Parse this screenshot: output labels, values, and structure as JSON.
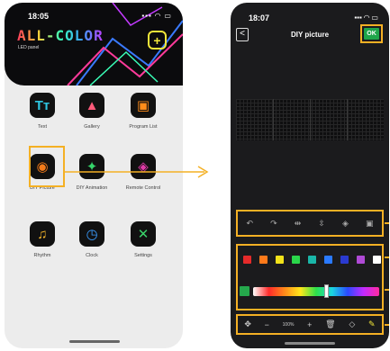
{
  "phone_left": {
    "time": "18:05",
    "status_icons": "▪▪▪ ◠ ▭",
    "logo": "ALL-COLOR",
    "subtitle": "LED panel",
    "add_symbol": "+",
    "tiles": [
      {
        "label": "Text",
        "icon": "text-icon",
        "glyph": "Tт",
        "color": "#2ec5e0"
      },
      {
        "label": "Gallery",
        "icon": "gallery-icon",
        "glyph": "▲",
        "color": "#ff5a7a"
      },
      {
        "label": "Program List",
        "icon": "program-list-icon",
        "glyph": "▣",
        "color": "#ff8c1a"
      },
      {
        "label": "DIY Picture",
        "icon": "palette-icon",
        "glyph": "◉",
        "color": "#f47b1a"
      },
      {
        "label": "DIY Animation",
        "icon": "running-figure-icon",
        "glyph": "✦",
        "color": "#35d46a"
      },
      {
        "label": "Remote Control",
        "icon": "gamepad-icon",
        "glyph": "◈",
        "color": "#e23aa8"
      },
      {
        "label": "Rhythm",
        "icon": "music-note-icon",
        "glyph": "♫",
        "color": "#f5b52a"
      },
      {
        "label": "Clock",
        "icon": "clock-icon",
        "glyph": "◷",
        "color": "#3a9cff"
      },
      {
        "label": "Settings",
        "icon": "tools-icon",
        "glyph": "✕",
        "color": "#3ad46a"
      }
    ]
  },
  "phone_right": {
    "time": "18:07",
    "status_icons": "▪▪▪ ◠ ▭",
    "title": "DIY picture",
    "back_symbol": "<",
    "ok_label": "OK",
    "toolbar": [
      {
        "icon": "undo-icon",
        "glyph": "↶"
      },
      {
        "icon": "redo-icon",
        "glyph": "↷"
      },
      {
        "icon": "flip-horizontal-icon",
        "glyph": "⇹"
      },
      {
        "icon": "flip-vertical-icon",
        "glyph": "⇳"
      },
      {
        "icon": "layers-icon",
        "glyph": "◈"
      },
      {
        "icon": "image-import-icon",
        "glyph": "▣"
      }
    ],
    "swatches": [
      "#e62a2a",
      "#ff7a1a",
      "#f2e21a",
      "#2ad64a",
      "#1ab6a8",
      "#2a7aff",
      "#2a3ad0",
      "#b04ad6",
      "#ffffff"
    ],
    "current_color": "#25a84c",
    "bottom_tools": [
      {
        "icon": "move-icon",
        "glyph": "✥"
      },
      {
        "icon": "zoom-out-icon",
        "glyph": "−"
      },
      {
        "icon": "zoom-level",
        "glyph": "100%"
      },
      {
        "icon": "zoom-in-icon",
        "glyph": "+"
      },
      {
        "icon": "trash-icon",
        "glyph": "🗑"
      },
      {
        "icon": "eraser-icon",
        "glyph": "◇"
      },
      {
        "icon": "pencil-icon",
        "glyph": "✎"
      }
    ],
    "highlight_color": "#f4b024"
  }
}
